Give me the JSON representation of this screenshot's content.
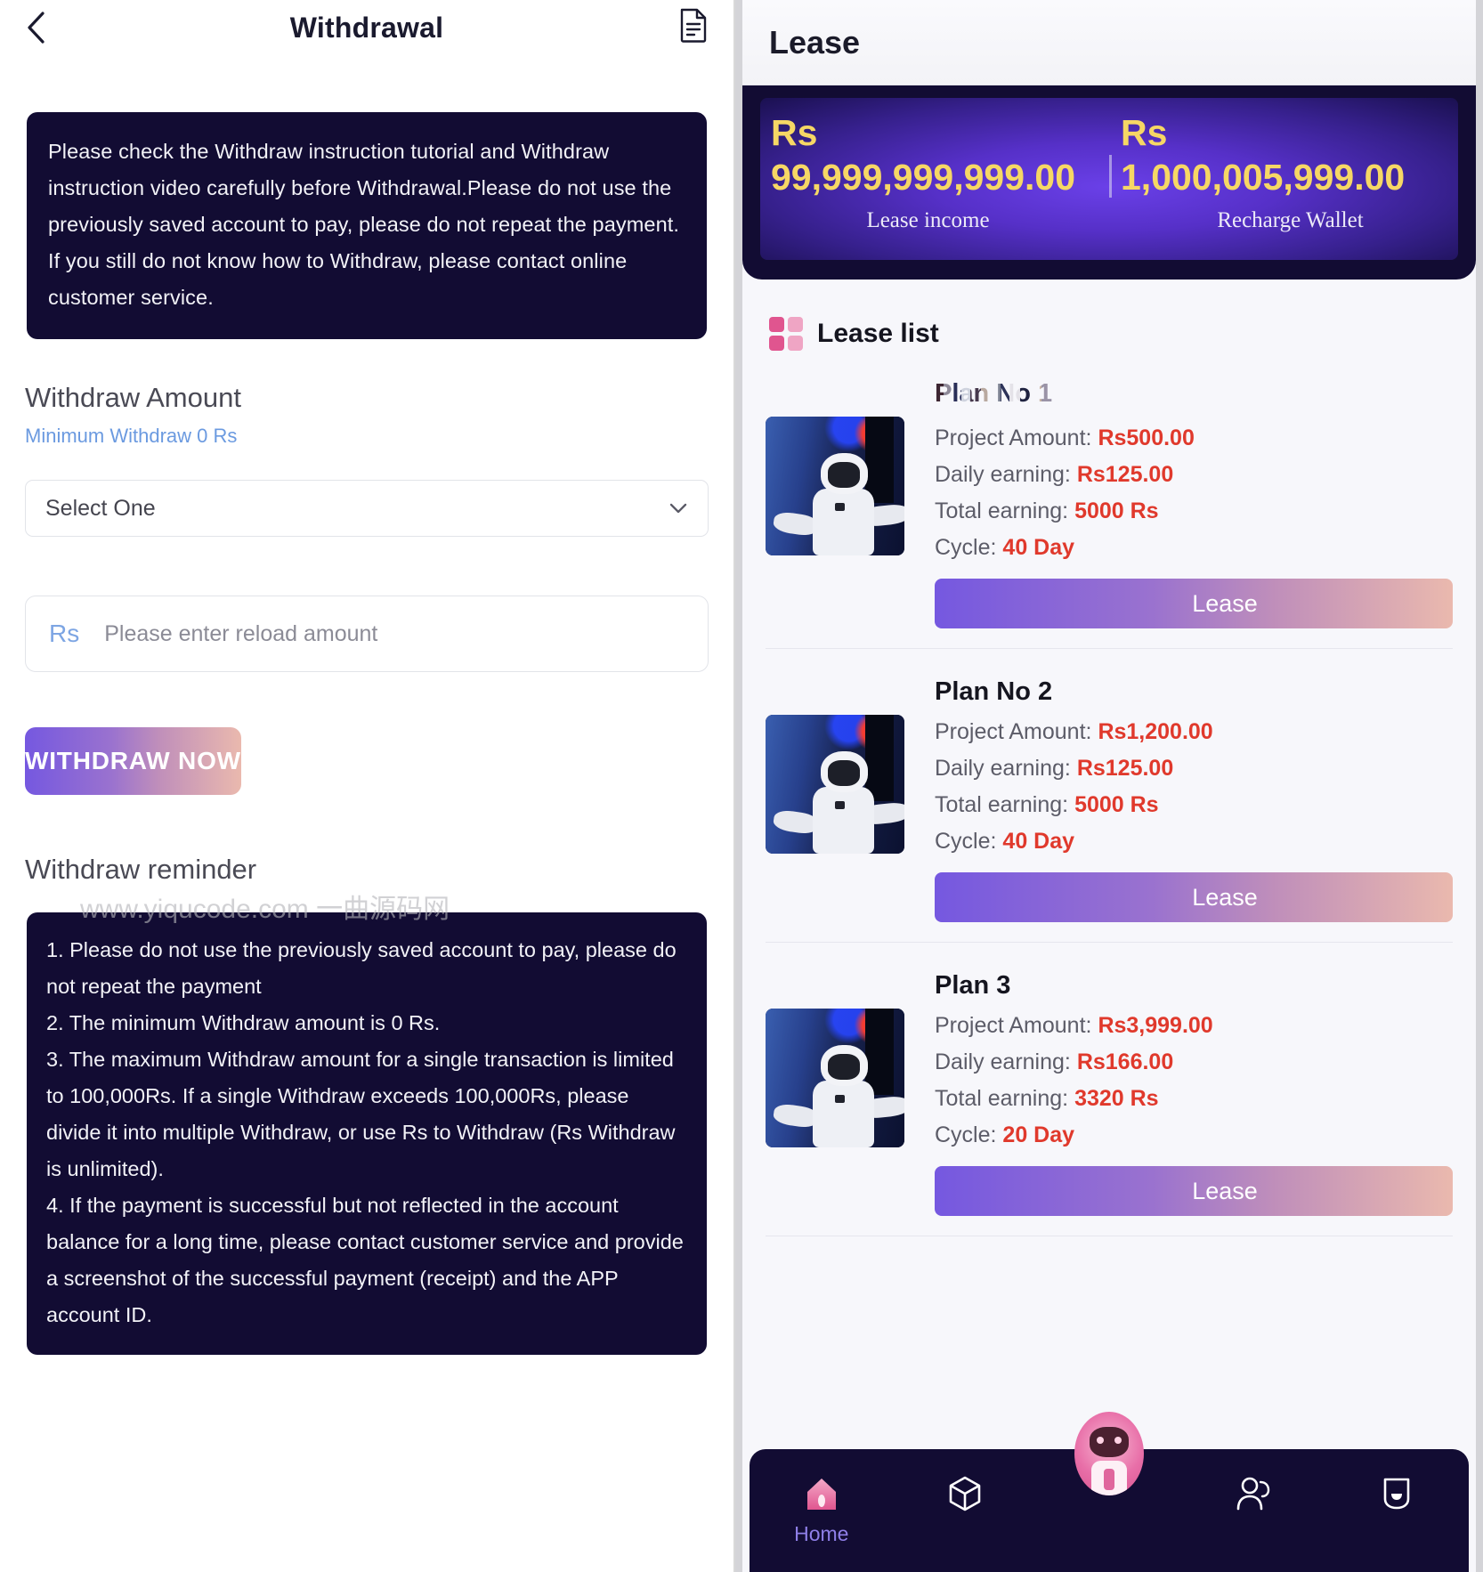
{
  "withdrawal": {
    "header": {
      "title": "Withdrawal",
      "back_icon": "chevron-left-icon",
      "record_icon": "document-icon"
    },
    "notice": "Please check the Withdraw instruction tutorial and Withdraw instruction video carefully before Withdrawal.Please do not use the previously saved account to pay, please do not repeat the payment. If you still do not know how to Withdraw, please contact online customer service.",
    "amount_section": {
      "title": "Withdraw Amount",
      "minimum_note": "Minimum Withdraw 0 Rs",
      "select_value": "Select One",
      "select_chevron_icon": "chevron-down-icon",
      "currency_prefix": "Rs",
      "amount_placeholder": "Please enter reload amount",
      "amount_value": ""
    },
    "submit_label": "WITHDRAW NOW",
    "reminder": {
      "title": "Withdraw reminder",
      "watermark": "www.yiqucode.com 一曲源码网",
      "items": [
        "1. Please do not use the previously saved account to pay, please do not repeat the payment",
        "2. The minimum Withdraw amount is 0 Rs.",
        "3. The maximum Withdraw amount for a single transaction is limited to 100,000Rs. If a single Withdraw exceeds 100,000Rs, please divide it into multiple Withdraw, or use Rs to Withdraw (Rs Withdraw is unlimited).",
        "4. If the payment is successful but not reflected in the account balance for a long time, please contact customer service and provide a screenshot of the successful payment (receipt) and the APP account ID."
      ]
    }
  },
  "lease": {
    "header": {
      "title": "Lease"
    },
    "balance": {
      "left": {
        "currency": "Rs",
        "amount": "99,999,999,999.00",
        "label": "Lease income"
      },
      "right": {
        "currency": "Rs",
        "amount": "1,000,005,999.00",
        "label": "Recharge Wallet"
      }
    },
    "list": {
      "icon": "grid-squares-icon",
      "label": "Lease list",
      "field_labels": {
        "project_amount": "Project Amount:",
        "daily_earning": "Daily earning:",
        "total_earning": "Total earning:",
        "cycle": "Cycle:"
      },
      "plans": [
        {
          "name": "Plan No 1",
          "name_masked": true,
          "thumbnail_icon": "robot-photo",
          "project_amount": "Rs500.00",
          "daily_earning": "Rs125.00",
          "total_earning": "5000 Rs",
          "cycle": "40 Day",
          "button_label": "Lease"
        },
        {
          "name": "Plan No 2",
          "name_masked": false,
          "thumbnail_icon": "robot-photo",
          "project_amount": "Rs1,200.00",
          "daily_earning": "Rs125.00",
          "total_earning": "5000 Rs",
          "cycle": "40 Day",
          "button_label": "Lease"
        },
        {
          "name": "Plan 3",
          "name_masked": false,
          "thumbnail_icon": "robot-photo",
          "project_amount": "Rs3,999.00",
          "daily_earning": "Rs166.00",
          "total_earning": "3320 Rs",
          "cycle": "20 Day",
          "button_label": "Lease"
        }
      ]
    },
    "bottom_nav": {
      "items": [
        {
          "icon": "home-icon",
          "label": "Home",
          "active": true
        },
        {
          "icon": "cube-icon",
          "label": "",
          "active": false
        },
        {
          "icon": "users-icon",
          "label": "",
          "active": false
        },
        {
          "icon": "chat-smile-icon",
          "label": "",
          "active": false
        }
      ],
      "fab_icon": "robot-assistant-icon"
    }
  },
  "colors": {
    "dark_navy": "#120c33",
    "accent_purple": "#7558e0",
    "accent_pink": "#eab9ae",
    "value_red": "#e0392c",
    "gold": "#f6d765",
    "link_blue": "#6b9ae0",
    "nav_active": "#8f7fe8"
  }
}
